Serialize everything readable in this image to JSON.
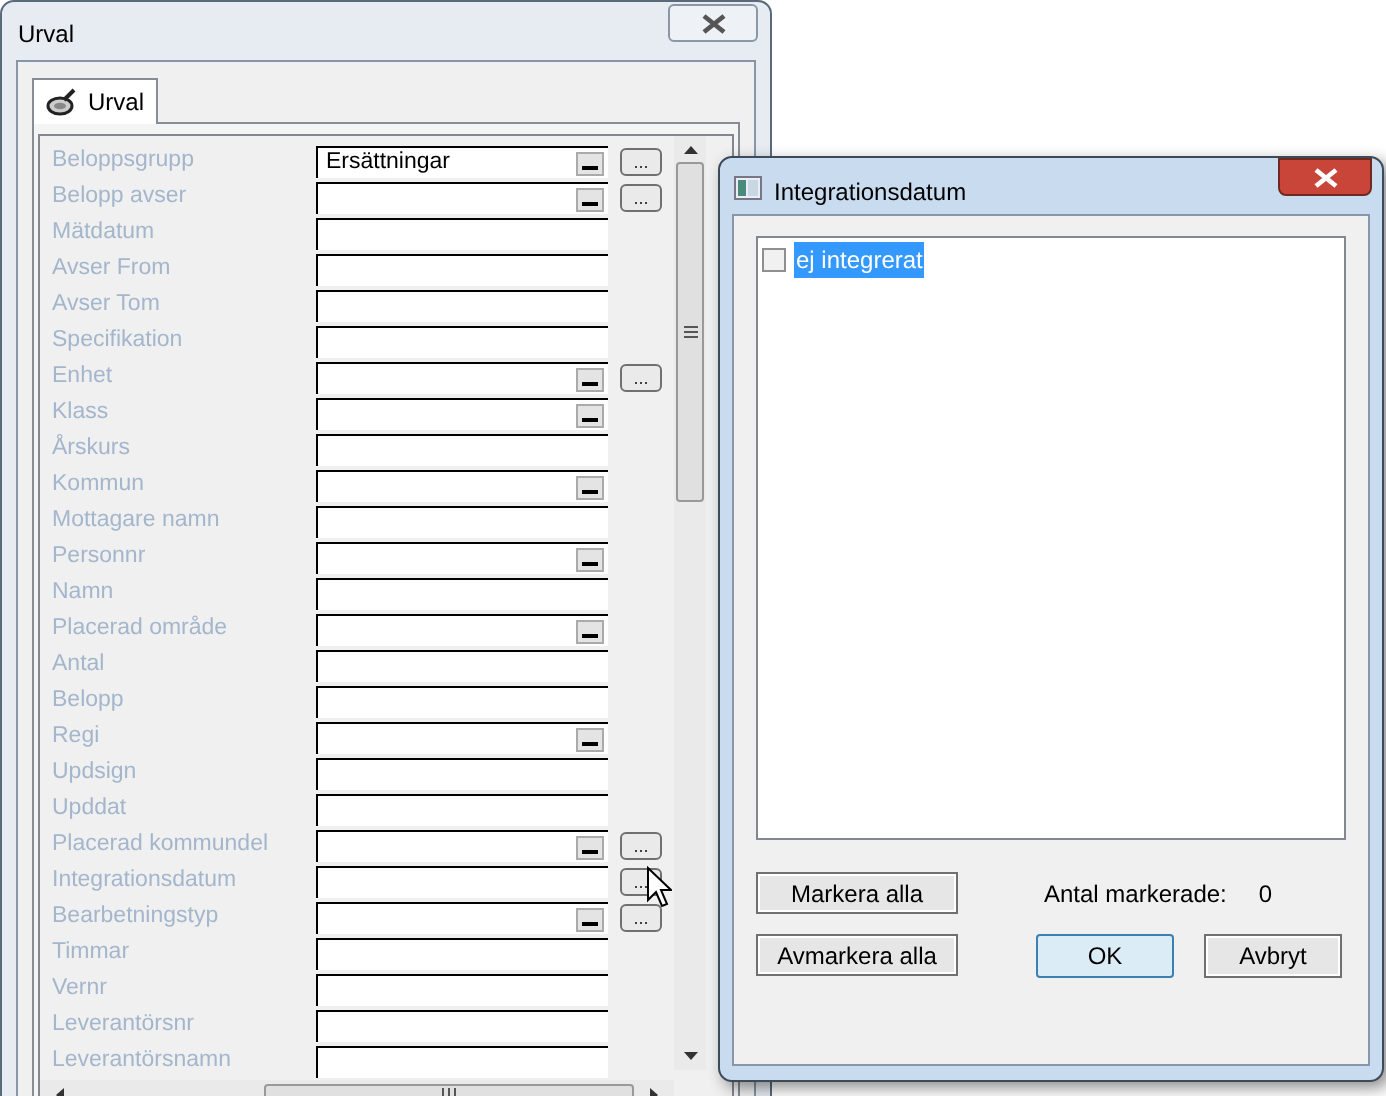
{
  "main_window": {
    "title": "Urval",
    "tabs": [
      {
        "label": "Urval",
        "selected": true
      }
    ],
    "fields": [
      {
        "label": "Beloppsgrupp",
        "kind": "combo",
        "value": "Ersättningar",
        "button": "..."
      },
      {
        "label": "Belopp avser",
        "kind": "combo",
        "button": "..."
      },
      {
        "label": "Mätdatum",
        "kind": "text"
      },
      {
        "label": "Avser From",
        "kind": "text"
      },
      {
        "label": "Avser Tom",
        "kind": "text"
      },
      {
        "label": "Specifikation",
        "kind": "text"
      },
      {
        "label": "Enhet",
        "kind": "combo",
        "button": "..."
      },
      {
        "label": "Klass",
        "kind": "combo"
      },
      {
        "label": "Årskurs",
        "kind": "text"
      },
      {
        "label": "Kommun",
        "kind": "combo"
      },
      {
        "label": "Mottagare namn",
        "kind": "text"
      },
      {
        "label": "Personnr",
        "kind": "combo"
      },
      {
        "label": "Namn",
        "kind": "text"
      },
      {
        "label": "Placerad område",
        "kind": "combo"
      },
      {
        "label": "Antal",
        "kind": "text"
      },
      {
        "label": "Belopp",
        "kind": "text"
      },
      {
        "label": "Regi",
        "kind": "combo"
      },
      {
        "label": "Updsign",
        "kind": "text"
      },
      {
        "label": "Upddat",
        "kind": "text"
      },
      {
        "label": "Placerad kommundel",
        "kind": "combo",
        "button": "..."
      },
      {
        "label": "Integrationsdatum",
        "kind": "text",
        "button": "..."
      },
      {
        "label": "Bearbetningstyp",
        "kind": "combo",
        "button": "..."
      },
      {
        "label": "Timmar",
        "kind": "text"
      },
      {
        "label": "Vernr",
        "kind": "text"
      },
      {
        "label": "Leverantörsnr",
        "kind": "text"
      },
      {
        "label": "Leverantörsnamn",
        "kind": "text"
      }
    ]
  },
  "dialog": {
    "title": "Integrationsdatum",
    "items": [
      {
        "label": "ej integrerat",
        "checked": false,
        "selected": true
      }
    ],
    "select_all": "Markera alla",
    "deselect_all": "Avmarkera alla",
    "count_label": "Antal markerade:",
    "count": "0",
    "ok": "OK",
    "cancel": "Avbryt"
  }
}
